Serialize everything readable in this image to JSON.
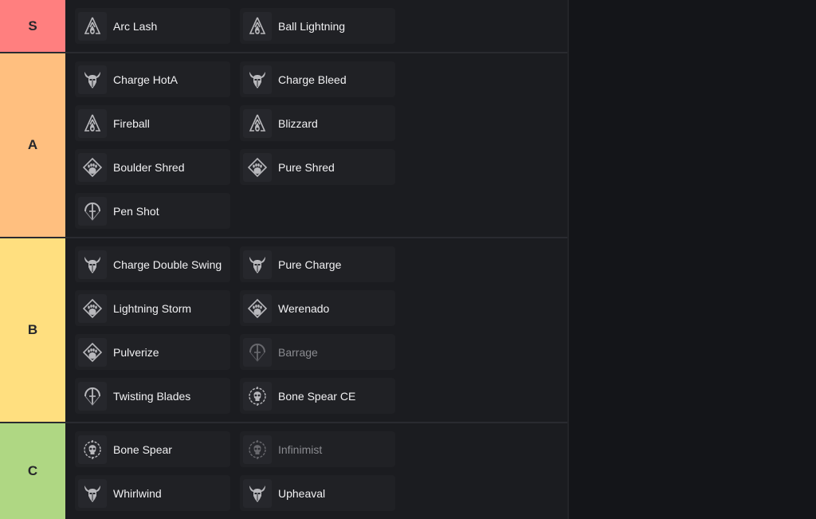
{
  "tiers": [
    {
      "label": "S",
      "color": "#ff7f7f",
      "items": [
        {
          "name": "Arc Lash",
          "icon": "sorcerer-icon",
          "dim": false
        },
        {
          "name": "Ball Lightning",
          "icon": "sorcerer-icon",
          "dim": false
        }
      ]
    },
    {
      "label": "A",
      "color": "#ffbf7f",
      "items": [
        {
          "name": "Charge HotA",
          "icon": "barbarian-icon",
          "dim": false
        },
        {
          "name": "Charge Bleed",
          "icon": "barbarian-icon",
          "dim": false
        },
        {
          "name": "Fireball",
          "icon": "sorcerer-icon",
          "dim": false
        },
        {
          "name": "Blizzard",
          "icon": "sorcerer-icon",
          "dim": false
        },
        {
          "name": "Boulder Shred",
          "icon": "druid-icon",
          "dim": false
        },
        {
          "name": "Pure Shred",
          "icon": "druid-icon",
          "dim": false
        },
        {
          "name": "Pen Shot",
          "icon": "rogue-icon",
          "dim": false
        }
      ]
    },
    {
      "label": "B",
      "color": "#ffdf7f",
      "items": [
        {
          "name": "Charge Double Swing",
          "icon": "barbarian-icon",
          "dim": false
        },
        {
          "name": "Pure Charge",
          "icon": "barbarian-icon",
          "dim": false
        },
        {
          "name": "Lightning Storm",
          "icon": "druid-icon",
          "dim": false
        },
        {
          "name": "Werenado",
          "icon": "druid-icon",
          "dim": false
        },
        {
          "name": "Pulverize",
          "icon": "druid-icon",
          "dim": false
        },
        {
          "name": "Barrage",
          "icon": "rogue-icon",
          "dim": true
        },
        {
          "name": "Twisting Blades",
          "icon": "rogue-icon",
          "dim": false
        },
        {
          "name": "Bone Spear CE",
          "icon": "necromancer-icon",
          "dim": false
        }
      ]
    },
    {
      "label": "C",
      "color": "#afd783",
      "items": [
        {
          "name": "Bone Spear",
          "icon": "necromancer-icon",
          "dim": false
        },
        {
          "name": "Infinimist",
          "icon": "necromancer-icon",
          "dim": true
        },
        {
          "name": "Whirlwind",
          "icon": "barbarian-icon",
          "dim": false
        },
        {
          "name": "Upheaval",
          "icon": "barbarian-icon",
          "dim": false
        }
      ]
    }
  ]
}
